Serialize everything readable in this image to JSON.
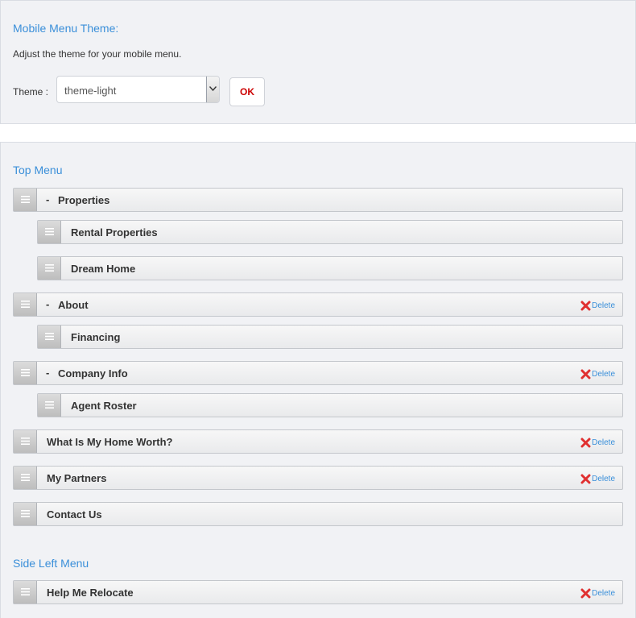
{
  "theme_section": {
    "title": "Mobile Menu Theme:",
    "description": "Adjust the theme for your mobile menu.",
    "theme_label": "Theme :",
    "select_value": "theme-light",
    "ok_label": "OK"
  },
  "top_menu": {
    "title": "Top Menu",
    "delete_label": "Delete",
    "items": [
      {
        "label": "Properties",
        "collapse": "-"
      },
      {
        "label": "Rental Properties"
      },
      {
        "label": "Dream Home"
      },
      {
        "label": "About",
        "collapse": "-"
      },
      {
        "label": "Financing"
      },
      {
        "label": "Company Info",
        "collapse": "-"
      },
      {
        "label": "Agent Roster"
      },
      {
        "label": "What Is My Home Worth?"
      },
      {
        "label": "My Partners"
      },
      {
        "label": "Contact Us"
      }
    ]
  },
  "side_left_menu": {
    "title": "Side Left Menu",
    "items": [
      {
        "label": "Help Me Relocate"
      }
    ]
  },
  "colors": {
    "accent": "#3a8fd9",
    "ok_text": "#cc0000",
    "delete_icon": "#e03030"
  },
  "icons": {
    "drag_handle": "hamburger-icon",
    "delete": "red-x-icon",
    "select_arrow": "chevron-down-icon"
  }
}
